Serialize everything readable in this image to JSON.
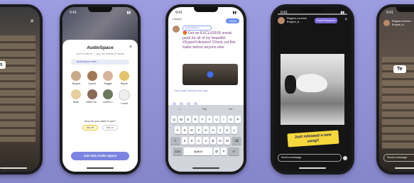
{
  "phone1": {
    "label": "In"
  },
  "phone2": {
    "time": "9:41",
    "title": "AudioSpace",
    "close": "×",
    "subtitle": "Join to listen in — you can request to speak",
    "pill": "AudioSpace invite",
    "avatars": [
      {
        "name": "Regina"
      },
      {
        "name": "Lauren"
      },
      {
        "name": "Maggie"
      },
      {
        "name": "Rhyne"
      },
      {
        "name": "Brian"
      },
      {
        "name": "Kathe Sa..."
      },
      {
        "name": "Lauren L."
      },
      {
        "name": "Chanelle"
      },
      {
        "name": "+ more"
      }
    ],
    "question": "How do you want to join?",
    "mic_off": "Mic off",
    "mic_on": "Mic on",
    "join": "Join this Audio Space"
  },
  "phone3": {
    "time": "9:41",
    "cancel": "Cancel",
    "tweet": "Tweet",
    "audience": "Superfollowers",
    "text": "🎁 Get an EXCLUSIVE sneak peek for all of my beautiful #SuperFollowers! Check out this trailer before anyone else",
    "reply_note": "Only SuperFollowers can reply",
    "suggestions": [
      "I",
      "The",
      "I'm"
    ],
    "row1": [
      "Q",
      "W",
      "E",
      "R",
      "T",
      "Y",
      "U",
      "I",
      "O",
      "P"
    ],
    "row2": [
      "A",
      "S",
      "D",
      "F",
      "G",
      "H",
      "J",
      "K",
      "L"
    ],
    "row3": [
      "Z",
      "X",
      "C",
      "V",
      "B",
      "N",
      "M"
    ],
    "num": "123",
    "space": "space",
    "at": "@",
    "hash": "#"
  },
  "phone4": {
    "time": "9:41",
    "user": "Regina Lorenzo",
    "meta": "Empire_b...",
    "badge": "SuperFollowers",
    "close": "×",
    "sticker": "Just released a new song!!",
    "message": "Send a message"
  },
  "phone5": {
    "time": "9:41",
    "user": "Regina Lorenzo",
    "meta": "Empire_b...",
    "label": "Te",
    "message": "Send a message"
  }
}
